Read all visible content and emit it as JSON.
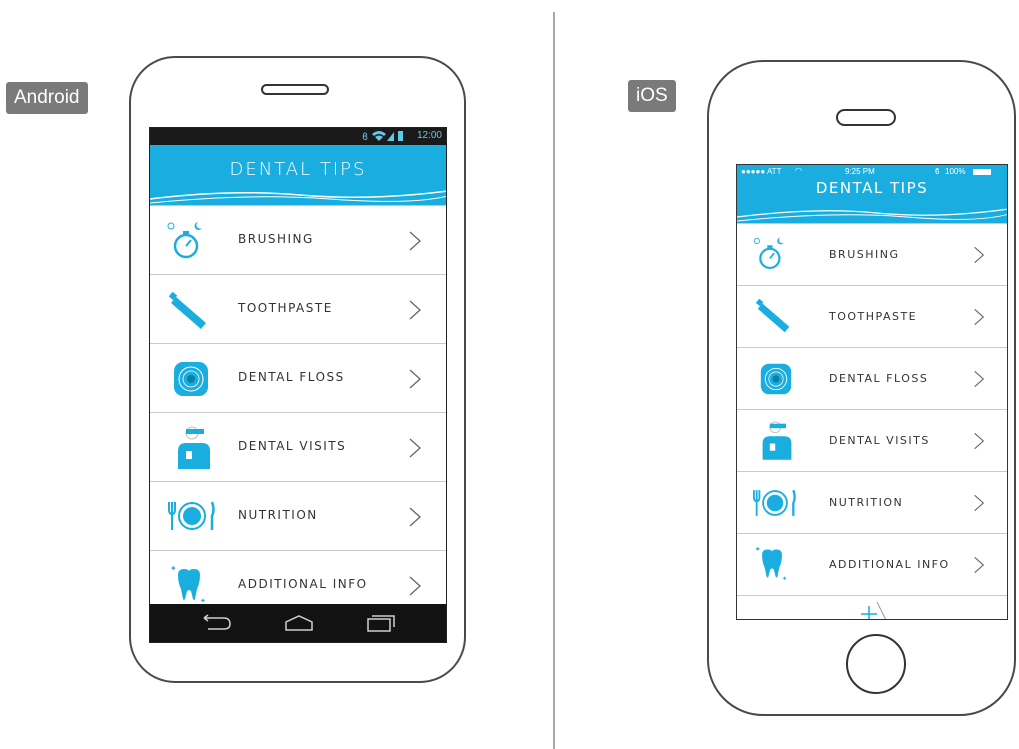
{
  "platforms": {
    "android_label": "Android",
    "ios_label": "iOS"
  },
  "colors": {
    "accent": "#1aaee0",
    "text": "#333333",
    "divider": "#c9c9c9"
  },
  "android": {
    "status_time": "12:00",
    "status_icons": [
      "bluetooth-icon",
      "wifi-icon",
      "signal-icon",
      "battery-icon"
    ],
    "header_title": "DENTAL TIPS",
    "nav_buttons": [
      "back-icon",
      "home-icon",
      "recent-apps-icon"
    ]
  },
  "ios": {
    "status_carrier": "●●●●● ATT",
    "status_time": "9:25 PM",
    "status_battery": "100%",
    "header_title": "DENTAL TIPS"
  },
  "menu_items": [
    {
      "label": "BRUSHING",
      "icon": "stopwatch-icon"
    },
    {
      "label": "TOOTHPASTE",
      "icon": "toothpaste-icon"
    },
    {
      "label": "DENTAL FLOSS",
      "icon": "dental-floss-icon"
    },
    {
      "label": "DENTAL VISITS",
      "icon": "dentist-icon"
    },
    {
      "label": "NUTRITION",
      "icon": "plate-cutlery-icon"
    },
    {
      "label": "ADDITIONAL INFO",
      "icon": "tooth-icon"
    }
  ]
}
